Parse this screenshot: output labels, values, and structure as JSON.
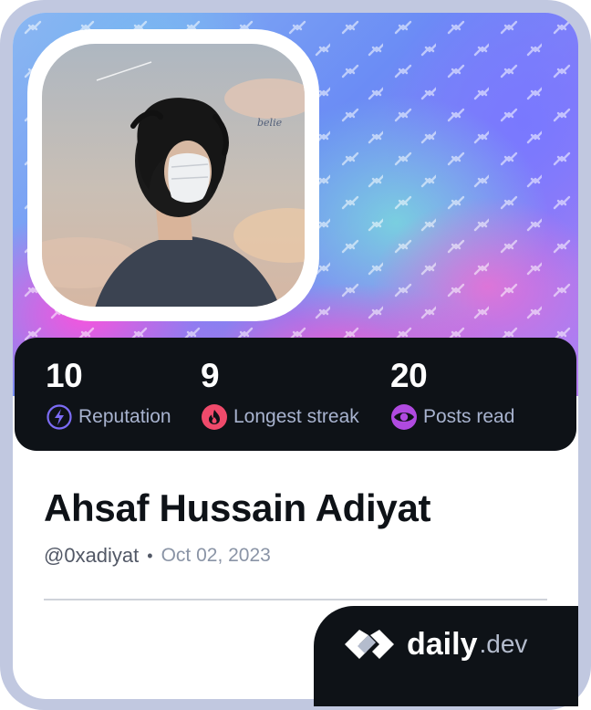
{
  "profile": {
    "name": "Ahsaf Hussain Adiyat",
    "handle": "@0xadiyat",
    "separator": "•",
    "joined": "Oct 02, 2023"
  },
  "stats": [
    {
      "value": "10",
      "label": "Reputation",
      "icon": "lightning-icon",
      "color": "#7c6cf5"
    },
    {
      "value": "9",
      "label": "Longest streak",
      "icon": "flame-icon",
      "color": "#ef4a6b"
    },
    {
      "value": "20",
      "label": "Posts read",
      "icon": "eye-icon",
      "color": "#b04ae0"
    }
  ],
  "brand": {
    "name": "daily",
    "tld": ".dev"
  },
  "colors": {
    "dark": "#0e1217",
    "muted": "#a8b3cf",
    "frame": "#c1c8e0"
  }
}
